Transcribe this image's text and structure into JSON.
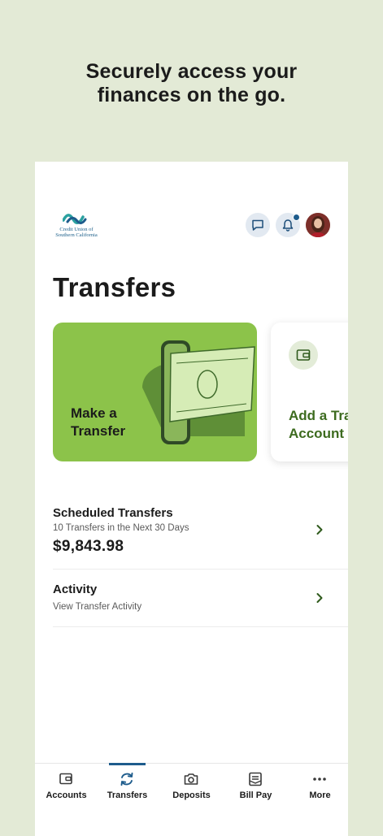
{
  "headline": {
    "line1": "Securely access your",
    "line2": "finances on the go."
  },
  "logo": {
    "line1": "Credit Union of",
    "line2": "Southern California"
  },
  "header_icons": [
    "chat-icon",
    "bell-icon",
    "avatar"
  ],
  "page_title": "Transfers",
  "cards": {
    "make_transfer": "Make a Transfer",
    "add_transfer": "Add a Transfer Account"
  },
  "scheduled": {
    "title": "Scheduled Transfers",
    "subtitle": "10 Transfers in the Next 30 Days",
    "amount": "$9,843.98"
  },
  "activity": {
    "title": "Activity",
    "subtitle": "View Transfer Activity"
  },
  "tabs": [
    {
      "label": "Accounts",
      "icon": "wallet-icon",
      "active": false
    },
    {
      "label": "Transfers",
      "icon": "transfer-arrows-icon",
      "active": true
    },
    {
      "label": "Deposits",
      "icon": "camera-icon",
      "active": false
    },
    {
      "label": "Bill Pay",
      "icon": "bill-icon",
      "active": false
    },
    {
      "label": "More",
      "icon": "more-dots-icon",
      "active": false
    }
  ],
  "colors": {
    "background": "#e3ead6",
    "card_green": "#8cc34a",
    "accent_blue": "#1e5c8c",
    "text_green": "#3d6b1f"
  }
}
